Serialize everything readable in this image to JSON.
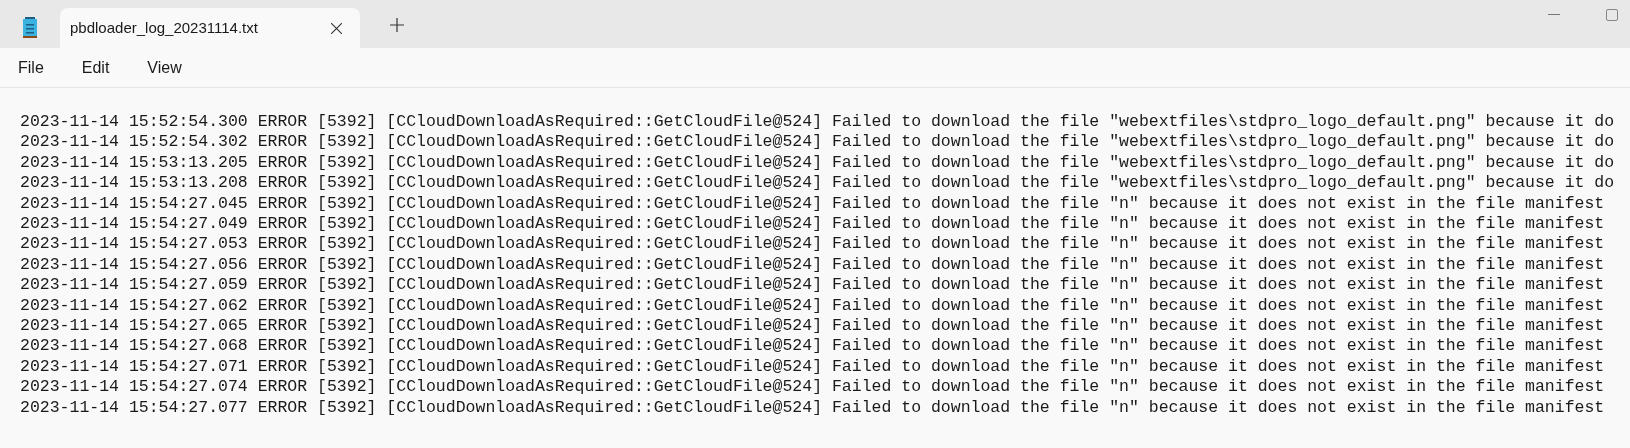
{
  "tabs": [
    {
      "title": "pbdloader_log_20231114.txt",
      "selected": true
    }
  ],
  "menu": [
    "File",
    "Edit",
    "View"
  ],
  "lines": [
    "2023-11-14 15:52:54.300 ERROR [5392] [CCloudDownloadAsRequired::GetCloudFile@524] Failed to download the file \"webextfiles\\stdpro_logo_default.png\" because it do",
    "2023-11-14 15:52:54.302 ERROR [5392] [CCloudDownloadAsRequired::GetCloudFile@524] Failed to download the file \"webextfiles\\stdpro_logo_default.png\" because it do",
    "2023-11-14 15:53:13.205 ERROR [5392] [CCloudDownloadAsRequired::GetCloudFile@524] Failed to download the file \"webextfiles\\stdpro_logo_default.png\" because it do",
    "2023-11-14 15:53:13.208 ERROR [5392] [CCloudDownloadAsRequired::GetCloudFile@524] Failed to download the file \"webextfiles\\stdpro_logo_default.png\" because it do",
    "2023-11-14 15:54:27.045 ERROR [5392] [CCloudDownloadAsRequired::GetCloudFile@524] Failed to download the file \"n\" because it does not exist in the file manifest",
    "2023-11-14 15:54:27.049 ERROR [5392] [CCloudDownloadAsRequired::GetCloudFile@524] Failed to download the file \"n\" because it does not exist in the file manifest",
    "2023-11-14 15:54:27.053 ERROR [5392] [CCloudDownloadAsRequired::GetCloudFile@524] Failed to download the file \"n\" because it does not exist in the file manifest",
    "2023-11-14 15:54:27.056 ERROR [5392] [CCloudDownloadAsRequired::GetCloudFile@524] Failed to download the file \"n\" because it does not exist in the file manifest",
    "2023-11-14 15:54:27.059 ERROR [5392] [CCloudDownloadAsRequired::GetCloudFile@524] Failed to download the file \"n\" because it does not exist in the file manifest",
    "2023-11-14 15:54:27.062 ERROR [5392] [CCloudDownloadAsRequired::GetCloudFile@524] Failed to download the file \"n\" because it does not exist in the file manifest",
    "2023-11-14 15:54:27.065 ERROR [5392] [CCloudDownloadAsRequired::GetCloudFile@524] Failed to download the file \"n\" because it does not exist in the file manifest",
    "2023-11-14 15:54:27.068 ERROR [5392] [CCloudDownloadAsRequired::GetCloudFile@524] Failed to download the file \"n\" because it does not exist in the file manifest",
    "2023-11-14 15:54:27.071 ERROR [5392] [CCloudDownloadAsRequired::GetCloudFile@524] Failed to download the file \"n\" because it does not exist in the file manifest",
    "2023-11-14 15:54:27.074 ERROR [5392] [CCloudDownloadAsRequired::GetCloudFile@524] Failed to download the file \"n\" because it does not exist in the file manifest",
    "2023-11-14 15:54:27.077 ERROR [5392] [CCloudDownloadAsRequired::GetCloudFile@524] Failed to download the file \"n\" because it does not exist in the file manifest"
  ]
}
